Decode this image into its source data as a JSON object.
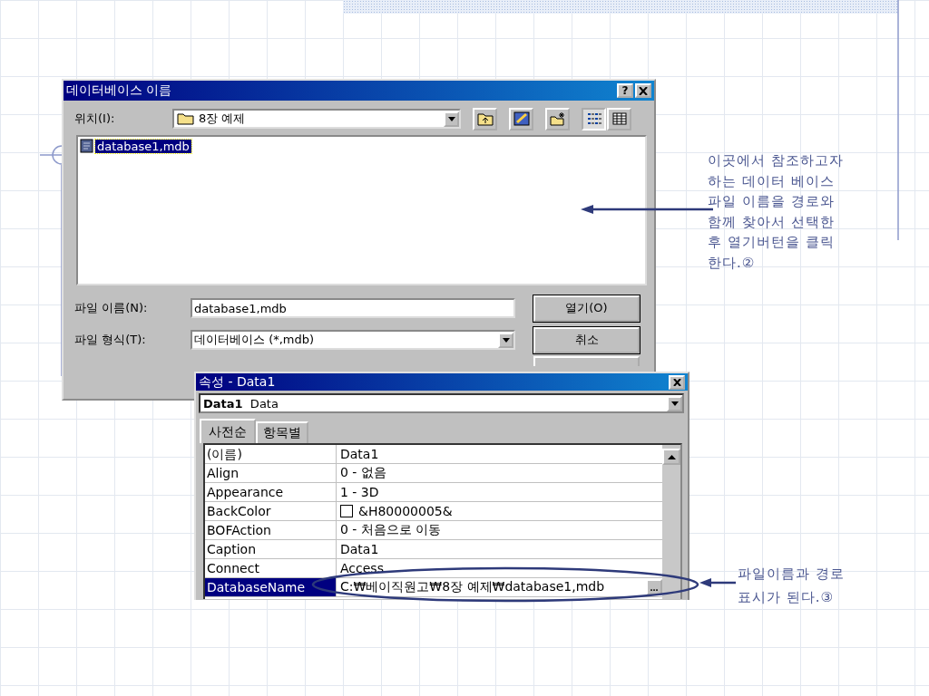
{
  "file_dialog": {
    "title": "데이터베이스 이름",
    "help_button": "?",
    "location": {
      "label": "위치(I):",
      "value": "8장 예제"
    },
    "files": [
      {
        "name": "database1,mdb",
        "selected": true
      }
    ],
    "file_name": {
      "label": "파일 이름(N):",
      "value": "database1,mdb"
    },
    "file_type": {
      "label": "파일 형식(T):",
      "value": "데이터베이스 (*,mdb)"
    },
    "buttons": [
      "열기(O)",
      "취소"
    ]
  },
  "properties_window": {
    "title": "속성 - Data1",
    "object": {
      "name": "Data1",
      "type": "Data"
    },
    "tabs": [
      {
        "label": "사전순",
        "selected": true
      },
      {
        "label": "항목별",
        "selected": false
      }
    ],
    "rows": [
      {
        "name": "(이름)",
        "value": "Data1",
        "kind": "text",
        "selected": false
      },
      {
        "name": "Align",
        "value": "0 - 없음",
        "kind": "text",
        "selected": false
      },
      {
        "name": "Appearance",
        "value": "1 - 3D",
        "kind": "text",
        "selected": false
      },
      {
        "name": "BackColor",
        "value": "&H80000005&",
        "kind": "color",
        "selected": false
      },
      {
        "name": "BOFAction",
        "value": "0 - 처음으로 이동",
        "kind": "text",
        "selected": false
      },
      {
        "name": "Caption",
        "value": "Data1",
        "kind": "text",
        "selected": false
      },
      {
        "name": "Connect",
        "value": "Access",
        "kind": "text",
        "selected": false
      },
      {
        "name": "DatabaseName",
        "value": "C:₩베이직원고₩8장 예제₩database1,mdb",
        "kind": "browse",
        "button": "...",
        "selected": true
      }
    ]
  },
  "callouts": [
    {
      "text": "이곳에서 참조하고자\n하는 데이터 베이스\n파일 이름을 경로와\n함께 찾아서 선택한\n후 열기버턴을 클릭\n한다.②"
    },
    {
      "text": "파일이름과 경로\n표시가 된다.③"
    }
  ]
}
